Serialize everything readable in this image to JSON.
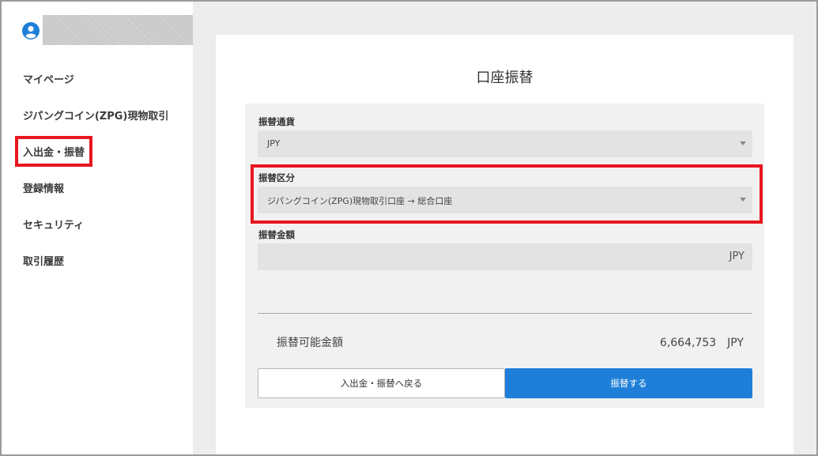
{
  "sidebar": {
    "avatar_icon": "user-circle-icon",
    "items": [
      {
        "label": "マイページ"
      },
      {
        "label": "ジパングコイン(ZPG)現物取引"
      },
      {
        "label": "入出金・振替"
      },
      {
        "label": "登録情報"
      },
      {
        "label": "セキュリティ"
      },
      {
        "label": "取引履歴"
      }
    ]
  },
  "main": {
    "title": "口座振替",
    "form": {
      "currency": {
        "label": "振替通貨",
        "value": "JPY"
      },
      "transfer_type": {
        "label": "振替区分",
        "value": "ジパングコイン(ZPG)現物取引口座 → 総合口座"
      },
      "amount": {
        "label": "振替金額",
        "value": "",
        "unit": "JPY"
      },
      "available": {
        "label": "振替可能金額",
        "value": "6,664,753　JPY"
      },
      "back_button": "入出金・振替へ戻る",
      "submit_button": "振替する"
    }
  },
  "colors": {
    "accent": "#1f7fd8",
    "highlight": "#e8161f",
    "avatar": "#1f7fd8"
  }
}
